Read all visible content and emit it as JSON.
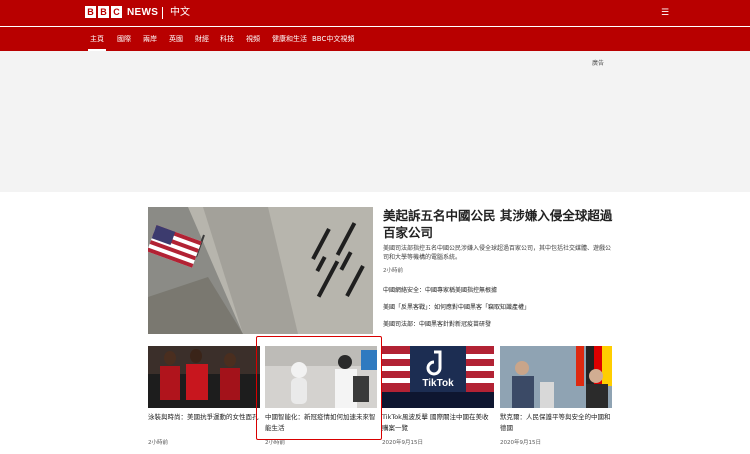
{
  "header": {
    "logo_letters": [
      "B",
      "B",
      "C"
    ],
    "brand": "NEWS",
    "language": "中文",
    "menu_icon": "menu-icon",
    "brand_color": "#b80000"
  },
  "nav": {
    "items": [
      {
        "label": "主頁"
      },
      {
        "label": "國際"
      },
      {
        "label": "兩岸"
      },
      {
        "label": "英國"
      },
      {
        "label": "財經"
      },
      {
        "label": "科技"
      },
      {
        "label": "視頻"
      },
      {
        "label": "健康和生活"
      },
      {
        "label": "BBC中文視頻"
      }
    ]
  },
  "ad": {
    "label": "廣告"
  },
  "top_story": {
    "headline": "美起訴五名中國公民 其涉嫌入侵全球超過百家公司",
    "summary": "美國司法部指控五名中國公民涉嫌入侵全球超過百家公司，其中包括社交媒體、遊戲公司和大學等機構的電腦系統。",
    "time": "2小時前"
  },
  "related": [
    {
      "text": "中國網絡安全：中國專家稱美國指控無根據"
    },
    {
      "text": "美國「反黑客戰」：如何應對中國黑客「竊取知識產權」"
    },
    {
      "text": "美國司法部：中國黑客針對新冠疫苗研發"
    }
  ],
  "stories": [
    {
      "title": "泳裝與時尚：美國抗爭運動的女性面孔",
      "time": "2小時前"
    },
    {
      "title": "中國智能化：新冠疫情如何加速未來智能生活",
      "time": "2小時前"
    },
    {
      "title": "TikTok風波反擊 國際關注中國在美收購案一覽",
      "time": "2020年9月15日"
    },
    {
      "title": "默克爾：人民保護平等與安全的中國和德國",
      "time": "2020年9月15日"
    }
  ]
}
